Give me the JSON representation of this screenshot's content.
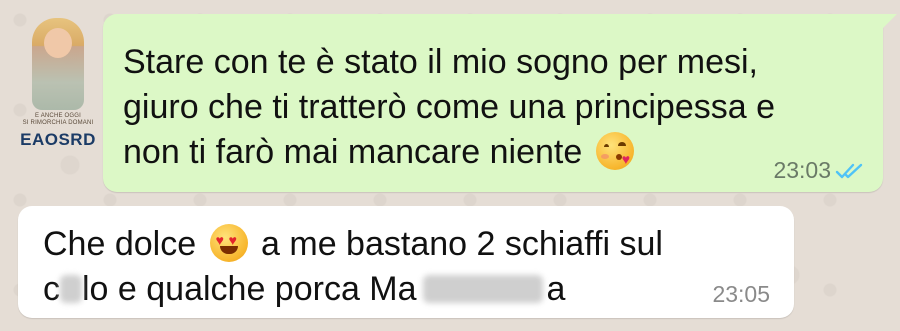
{
  "watermark": {
    "caption_line1": "E ANCHE OGGI",
    "caption_line2": "SI RIMORCHIA DOMANI",
    "brand": "EAOSRD"
  },
  "messages": [
    {
      "direction": "outgoing",
      "lines": [
        "Stare con te è stato il mio sogno per mesi,",
        "giuro che ti tratterò come una principessa e",
        "non ti farò mai mancare niente"
      ],
      "emoji": "kissing-face-with-heart-emoji",
      "time": "23:03",
      "status": "read",
      "bubble_color": "#dcf8c6",
      "tick_color": "#4fc3f7"
    },
    {
      "direction": "incoming",
      "line1_before_emoji": "Che dolce",
      "emoji": "heart-eyes-emoji",
      "line1_after_emoji": "a me bastano 2 schiaffi sul",
      "line2_start": "c",
      "line2_mid": "lo e qualche porca Ma",
      "line2_end": "a",
      "censored": true,
      "time": "23:05",
      "bubble_color": "#ffffff"
    }
  ],
  "colors": {
    "background": "#e5ddd5"
  }
}
